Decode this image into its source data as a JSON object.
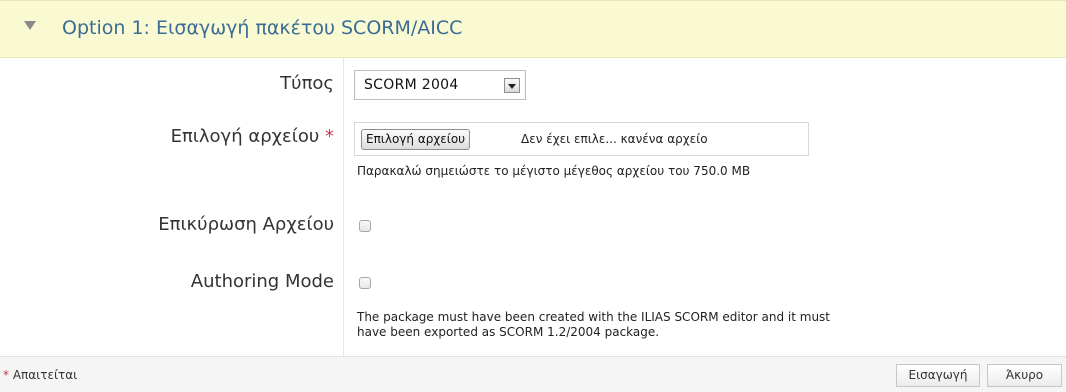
{
  "header": {
    "title": "Option 1: Εισαγωγή πακέτου SCORM/AICC"
  },
  "form": {
    "type_label": "Τύπος",
    "type_value": "SCORM 2004",
    "file_label": "Επιλογή αρχείου",
    "required_mark": "*",
    "file_button": "Επιλογή αρχείου",
    "file_status": "Δεν έχει επιλε... κανένα αρχείο",
    "file_hint": "Παρακαλώ σημειώστε το μέγιστο μέγεθος αρχείου του 750.0 MB",
    "validate_label": "Επικύρωση Αρχείου",
    "authoring_label": "Authoring Mode",
    "authoring_hint_1": "The package must have been created with the ILIAS SCORM editor and it must",
    "authoring_hint_2": "have been exported as SCORM 1.2/2004 package."
  },
  "footer": {
    "required_mark": "*",
    "required_text": "Απαιτείται",
    "import_button": "Εισαγωγή",
    "cancel_button": "Άκυρο"
  }
}
